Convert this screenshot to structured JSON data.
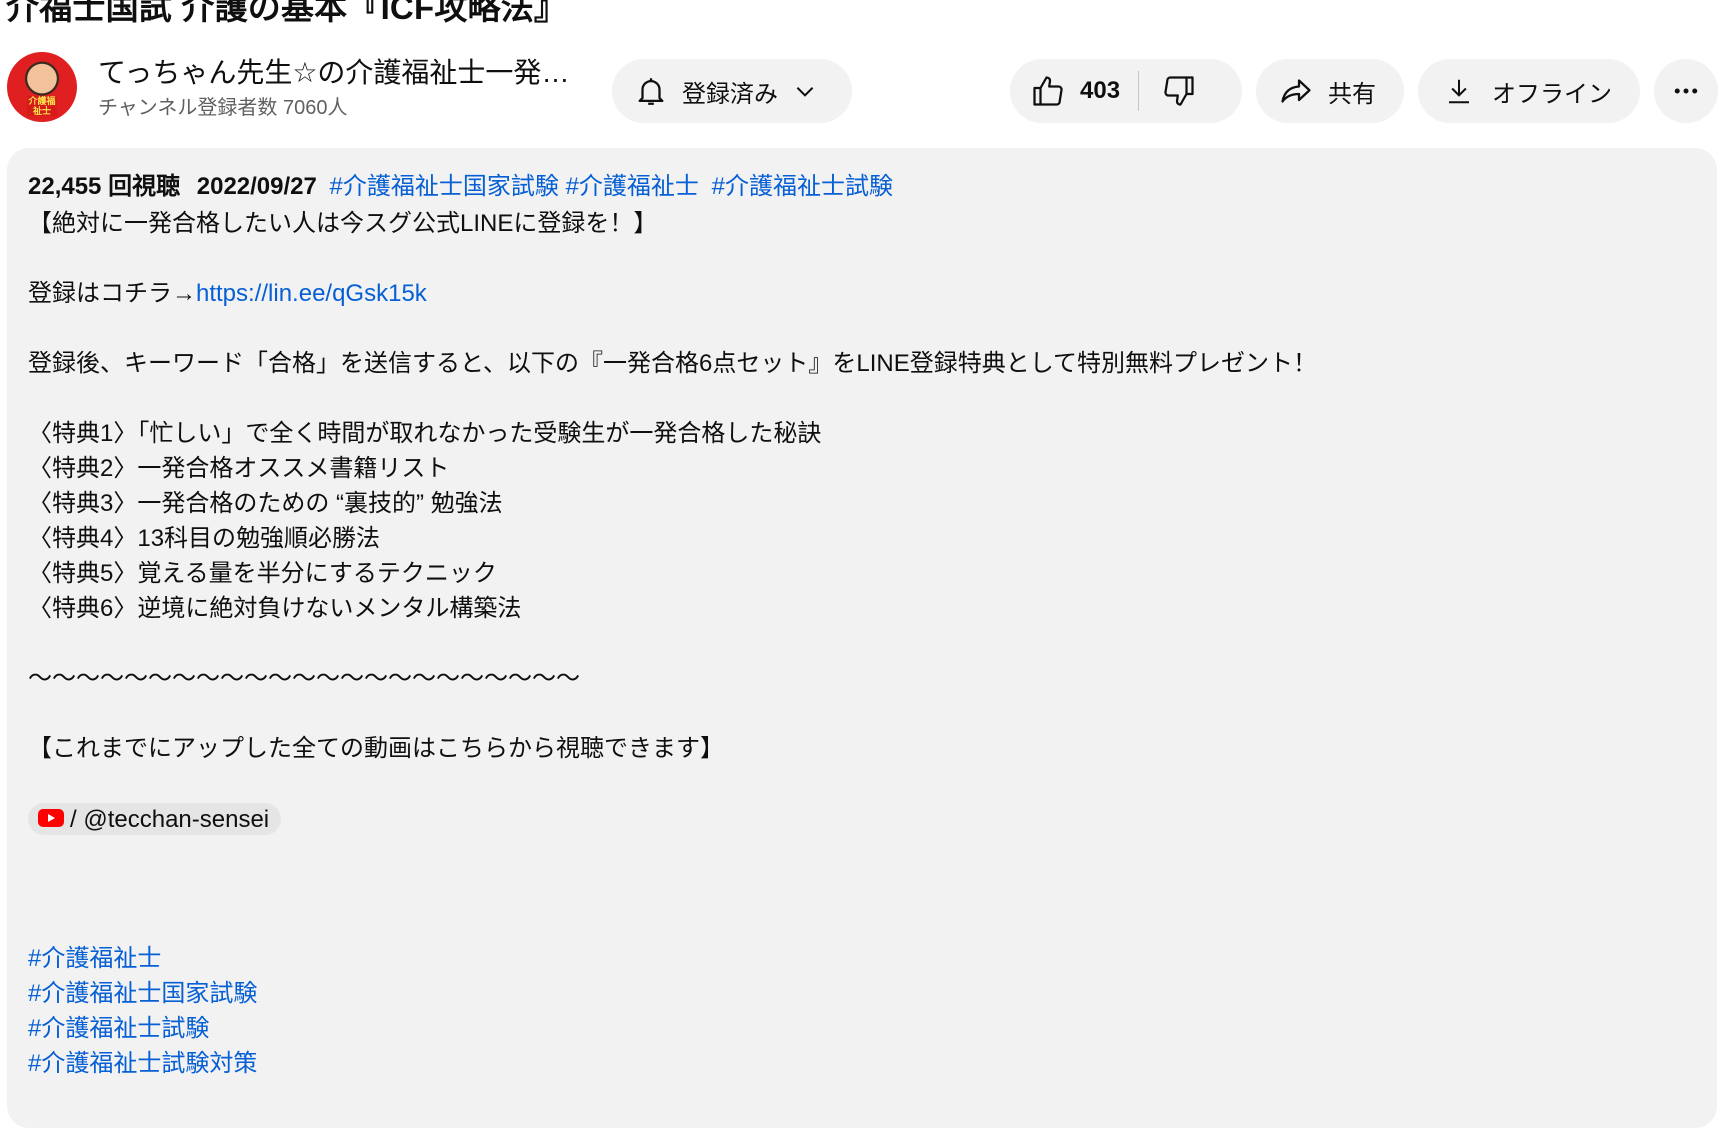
{
  "video": {
    "title": "介福士国試 介護の基本『ICF攻略法』"
  },
  "channel": {
    "name": "てっちゃん先生☆の介護福祉士一発合格チャンネル",
    "subscribers": "チャンネル登録者数 7060人",
    "avatar_text": "介護福祉士"
  },
  "actions": {
    "subscribe_label": "登録済み",
    "likes": "403",
    "share_label": "共有",
    "offline_label": "オフライン"
  },
  "description": {
    "views": "22,455 回視聴",
    "date": "2022/09/27",
    "header_tags": [
      "#介護福祉士国家試験",
      "#介護福祉士",
      "#介護福祉士試験"
    ],
    "line_intro": "【絶対に一発合格したい人は今スグ公式LINEに登録を！】",
    "register_prefix": "登録はコチラ→",
    "register_link": "https://lin.ee/qGsk15k",
    "keyword_line": "登録後、キーワード「合格」を送信すると、以下の『一発合格6点セット』をLINE登録特典として特別無料プレゼント！",
    "benefits": [
      "〈特典1〉「忙しい」で全く時間が取れなかった受験生が一発合格した秘訣",
      "〈特典2〉一発合格オススメ書籍リスト",
      "〈特典3〉一発合格のための “裏技的” 勉強法",
      "〈特典4〉13科目の勉強順必勝法",
      "〈特典5〉覚える量を半分にするテクニック",
      "〈特典6〉逆境に絶対負けないメンタル構築法"
    ],
    "divider": "〜〜〜〜〜〜〜〜〜〜〜〜〜〜〜〜〜〜〜〜〜〜〜",
    "videos_line": "【これまでにアップした全ての動画はこちらから視聴できます】",
    "channel_chip": "/ @tecchan-sensei",
    "footer_tags": [
      "#介護福祉士",
      "#介護福祉士国家試験",
      "#介護福祉士試験",
      "#介護福祉士試験対策"
    ]
  }
}
